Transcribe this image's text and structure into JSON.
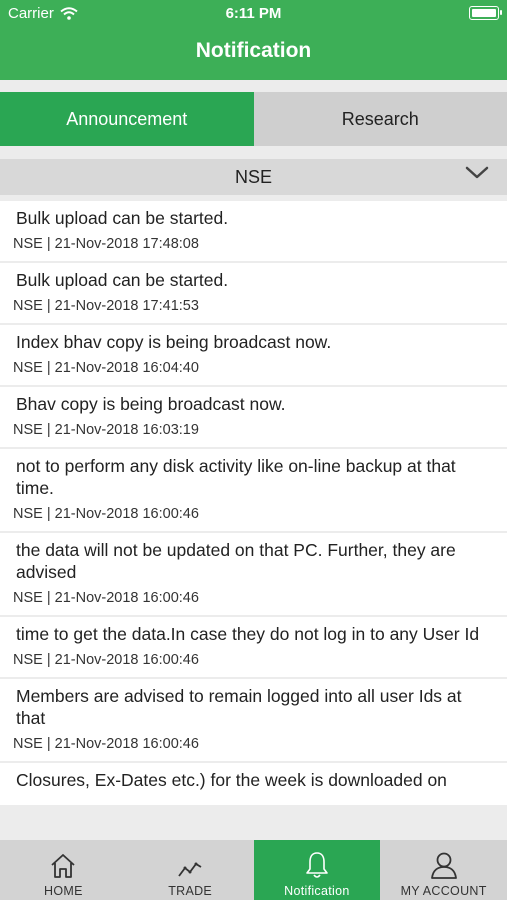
{
  "status_bar": {
    "carrier": "Carrier",
    "time": "6:11 PM"
  },
  "header": {
    "title": "Notification"
  },
  "tabs": [
    {
      "label": "Announcement",
      "active": true
    },
    {
      "label": "Research",
      "active": false
    }
  ],
  "filter": {
    "selected": "NSE"
  },
  "notifications": [
    {
      "message": "Bulk upload can be started.",
      "meta": "NSE | 21-Nov-2018 17:48:08"
    },
    {
      "message": "Bulk upload can be started.",
      "meta": "NSE | 21-Nov-2018 17:41:53"
    },
    {
      "message": "Index bhav copy is being broadcast now.",
      "meta": "NSE | 21-Nov-2018 16:04:40"
    },
    {
      "message": "Bhav copy is being broadcast now.",
      "meta": "NSE | 21-Nov-2018 16:03:19"
    },
    {
      "message": "not to perform any disk activity like on-line backup at that time.",
      "meta": "NSE | 21-Nov-2018 16:00:46"
    },
    {
      "message": "the data will not be updated on that PC. Further, they are advised",
      "meta": "NSE | 21-Nov-2018 16:00:46"
    },
    {
      "message": "time to get the data.In case they do not log in to any User Id",
      "meta": "NSE | 21-Nov-2018 16:00:46"
    },
    {
      "message": "Members are advised to remain logged into all user Ids at that",
      "meta": "NSE | 21-Nov-2018 16:00:46"
    },
    {
      "message": "Closures, Ex-Dates etc.) for the week is downloaded on",
      "meta": ""
    }
  ],
  "bottom_nav": [
    {
      "label": "HOME",
      "icon": "home-icon",
      "active": false
    },
    {
      "label": "TRADE",
      "icon": "trend-icon",
      "active": false
    },
    {
      "label": "Notification",
      "icon": "bell-icon",
      "active": true
    },
    {
      "label": "MY ACCOUNT",
      "icon": "person-icon",
      "active": false
    }
  ],
  "colors": {
    "primary": "#2aa653",
    "header": "#3daf57",
    "inactive_tab": "#cfcfcf"
  }
}
